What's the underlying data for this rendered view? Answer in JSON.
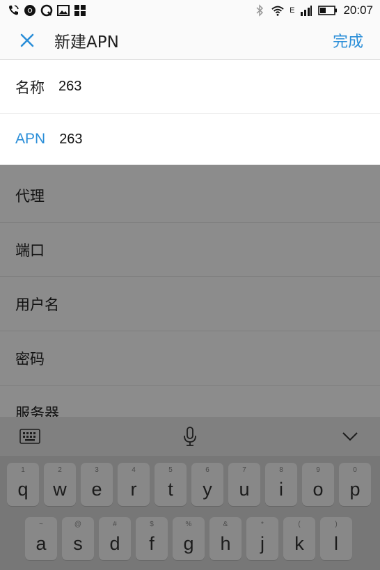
{
  "status_bar": {
    "time": "20:07",
    "network_type": "E",
    "left_icons": [
      "phone-call-icon",
      "chrome-icon",
      "qq-icon",
      "image-icon",
      "app-grid-icon"
    ],
    "right_icons": [
      "bluetooth-icon",
      "wifi-icon",
      "signal-icon",
      "battery-icon"
    ]
  },
  "header": {
    "title": "新建APN",
    "done_label": "完成",
    "close_icon": "close-icon",
    "accent_color": "#2a8ed8"
  },
  "fields": [
    {
      "label": "名称",
      "value": "263"
    },
    {
      "label": "APN",
      "value": "263"
    },
    {
      "label": "代理",
      "value": ""
    },
    {
      "label": "端口",
      "value": ""
    },
    {
      "label": "用户名",
      "value": ""
    },
    {
      "label": "密码",
      "value": ""
    },
    {
      "label": "服务器",
      "value": ""
    }
  ],
  "keyboard_toolbar": {
    "icons": [
      "keyboard-icon",
      "microphone-icon",
      "chevron-down-icon"
    ]
  },
  "keyboard": {
    "row1": [
      {
        "hint": "1",
        "key": "q"
      },
      {
        "hint": "2",
        "key": "w"
      },
      {
        "hint": "3",
        "key": "e"
      },
      {
        "hint": "4",
        "key": "r"
      },
      {
        "hint": "5",
        "key": "t"
      },
      {
        "hint": "6",
        "key": "y"
      },
      {
        "hint": "7",
        "key": "u"
      },
      {
        "hint": "8",
        "key": "i"
      },
      {
        "hint": "9",
        "key": "o"
      },
      {
        "hint": "0",
        "key": "p"
      }
    ],
    "row2": [
      {
        "hint": "~",
        "key": "a"
      },
      {
        "hint": "@",
        "key": "s"
      },
      {
        "hint": "#",
        "key": "d"
      },
      {
        "hint": "$",
        "key": "f"
      },
      {
        "hint": "%",
        "key": "g"
      },
      {
        "hint": "&",
        "key": "h"
      },
      {
        "hint": "*",
        "key": "j"
      },
      {
        "hint": "(",
        "key": "k"
      },
      {
        "hint": ")",
        "key": "l"
      }
    ]
  }
}
